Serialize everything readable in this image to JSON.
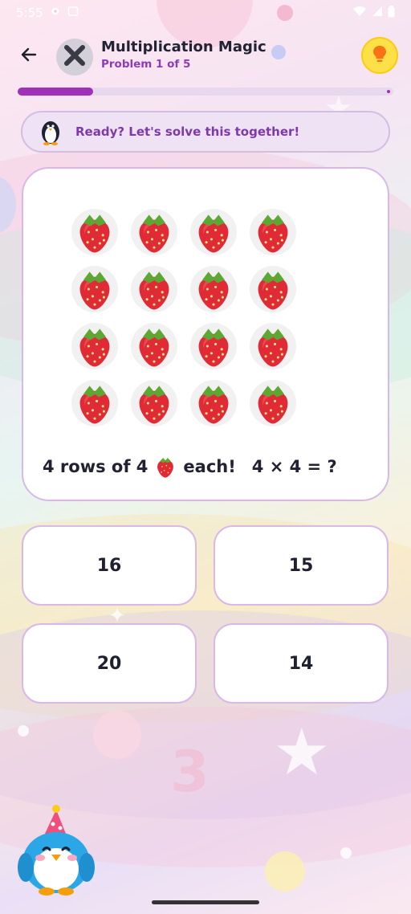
{
  "status_bar": {
    "time": "5:55",
    "icons": [
      "settings-icon",
      "screenshot-icon",
      "wifi-icon",
      "signal-icon",
      "battery-icon"
    ]
  },
  "header": {
    "back_icon": "arrow-left-icon",
    "avatar_icon": "close-x-icon",
    "title": "Multiplication Magic",
    "subtitle": "Problem 1 of 5",
    "hint_icon": "lightbulb-icon"
  },
  "progress": {
    "current": 1,
    "total": 5,
    "fraction": 0.2,
    "color": "#a030b8"
  },
  "message": {
    "icon": "penguin-icon",
    "text": "Ready? Let's solve this together!"
  },
  "problem": {
    "rows": 4,
    "cols": 4,
    "item_icon": "strawberry-icon",
    "text_prefix": "4 rows of 4",
    "text_suffix": "each!",
    "equation": "4 × 4 = ?"
  },
  "answers": [
    {
      "label": "16"
    },
    {
      "label": "15"
    },
    {
      "label": "20"
    },
    {
      "label": "14"
    }
  ],
  "mascot": {
    "icon": "penguin-party-hat-icon"
  },
  "colors": {
    "accent": "#a030b8",
    "card_border": "#d9b8e6",
    "hint_yellow": "#fde047",
    "strawberry_red": "#e02b36",
    "leaf_green": "#5ca832"
  }
}
